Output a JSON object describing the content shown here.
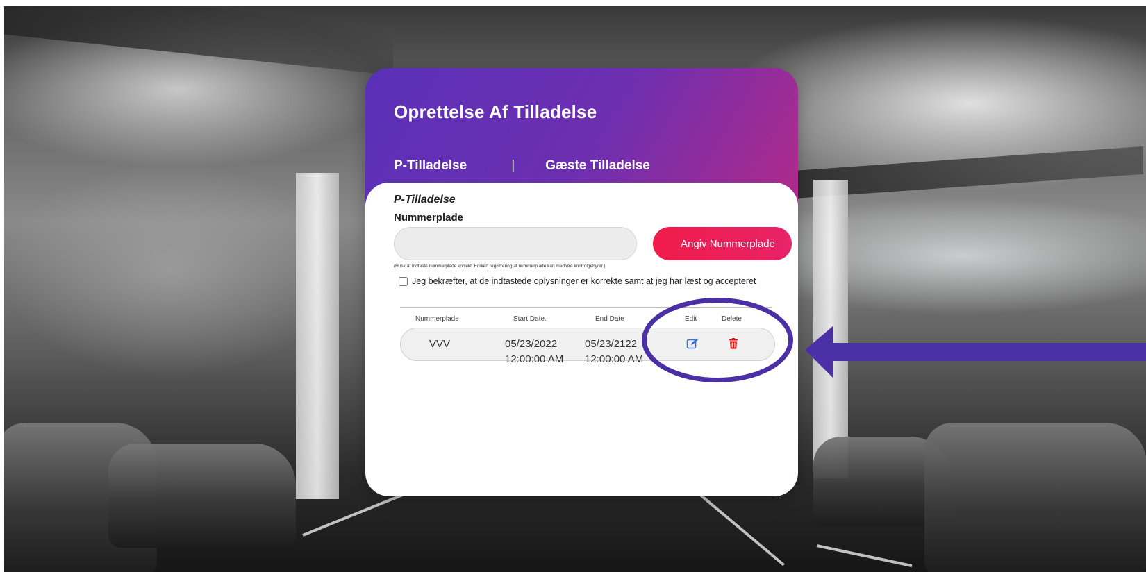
{
  "page": {
    "title": "Oprettelse Af Tilladelse",
    "tabs": [
      {
        "label": "P-Tilladelse"
      },
      {
        "label": "Gæste Tilladelse"
      }
    ],
    "tab_separator": "|"
  },
  "form": {
    "section_title": "P-Tilladelse",
    "field_label": "Nummerplade",
    "plate_value": "",
    "submit_label": "Angiv Nummerplade",
    "note": "(Husk at indtaste nummerplade korrekt. Forkert registrering af nummerplade kan medføre kontrolgebyrer.)",
    "confirm_label": "Jeg bekræfter, at de indtastede oplysninger er korrekte samt at jeg har læst og accepteret",
    "confirm_checked": false
  },
  "table": {
    "headers": [
      "Nummerplade",
      "Start Date.",
      "End Date",
      "Edit",
      "Delete"
    ],
    "rows": [
      {
        "plate": "VVV",
        "start_date": "05/23/2022",
        "start_time": "12:00:00 AM",
        "end_date": "05/23/2122",
        "end_time": "12:00:00 AM",
        "edit_icon": "edit-icon",
        "delete_icon": "trash-icon"
      }
    ]
  },
  "colors": {
    "header_gradient_start": "#5a30b8",
    "header_gradient_end": "#e0256d",
    "submit_button": "#f01c4a",
    "edit_icon": "#3b6fd6",
    "delete_icon": "#e01010",
    "annotation": "#4b2fa5"
  }
}
